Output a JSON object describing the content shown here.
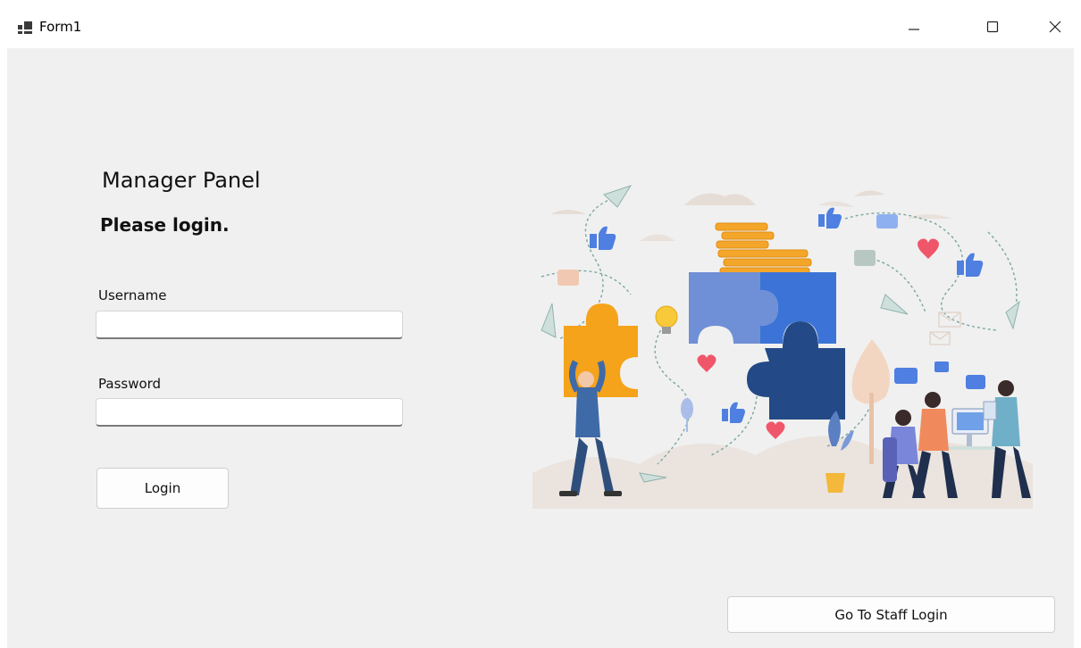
{
  "window": {
    "title": "Form1",
    "minimize_icon": "minimize-icon",
    "maximize_icon": "maximize-icon",
    "close_icon": "close-icon"
  },
  "panel": {
    "heading": "Manager Panel",
    "subheading": "Please login."
  },
  "form": {
    "username_label": "Username",
    "username_value": "",
    "password_label": "Password",
    "password_value": "",
    "login_button": "Login"
  },
  "footer": {
    "staff_login_button": "Go To Staff Login"
  },
  "illustration": {
    "subject": "teamwork-puzzle-illustration",
    "colors": {
      "puzzle_orange": "#f5a31a",
      "puzzle_light_blue": "#6f8fd6",
      "puzzle_blue": "#3b74d6",
      "puzzle_navy": "#234a86",
      "coins": "#f4a62a",
      "heart": "#f0566a",
      "thumbs": "#4f7fe0"
    }
  }
}
